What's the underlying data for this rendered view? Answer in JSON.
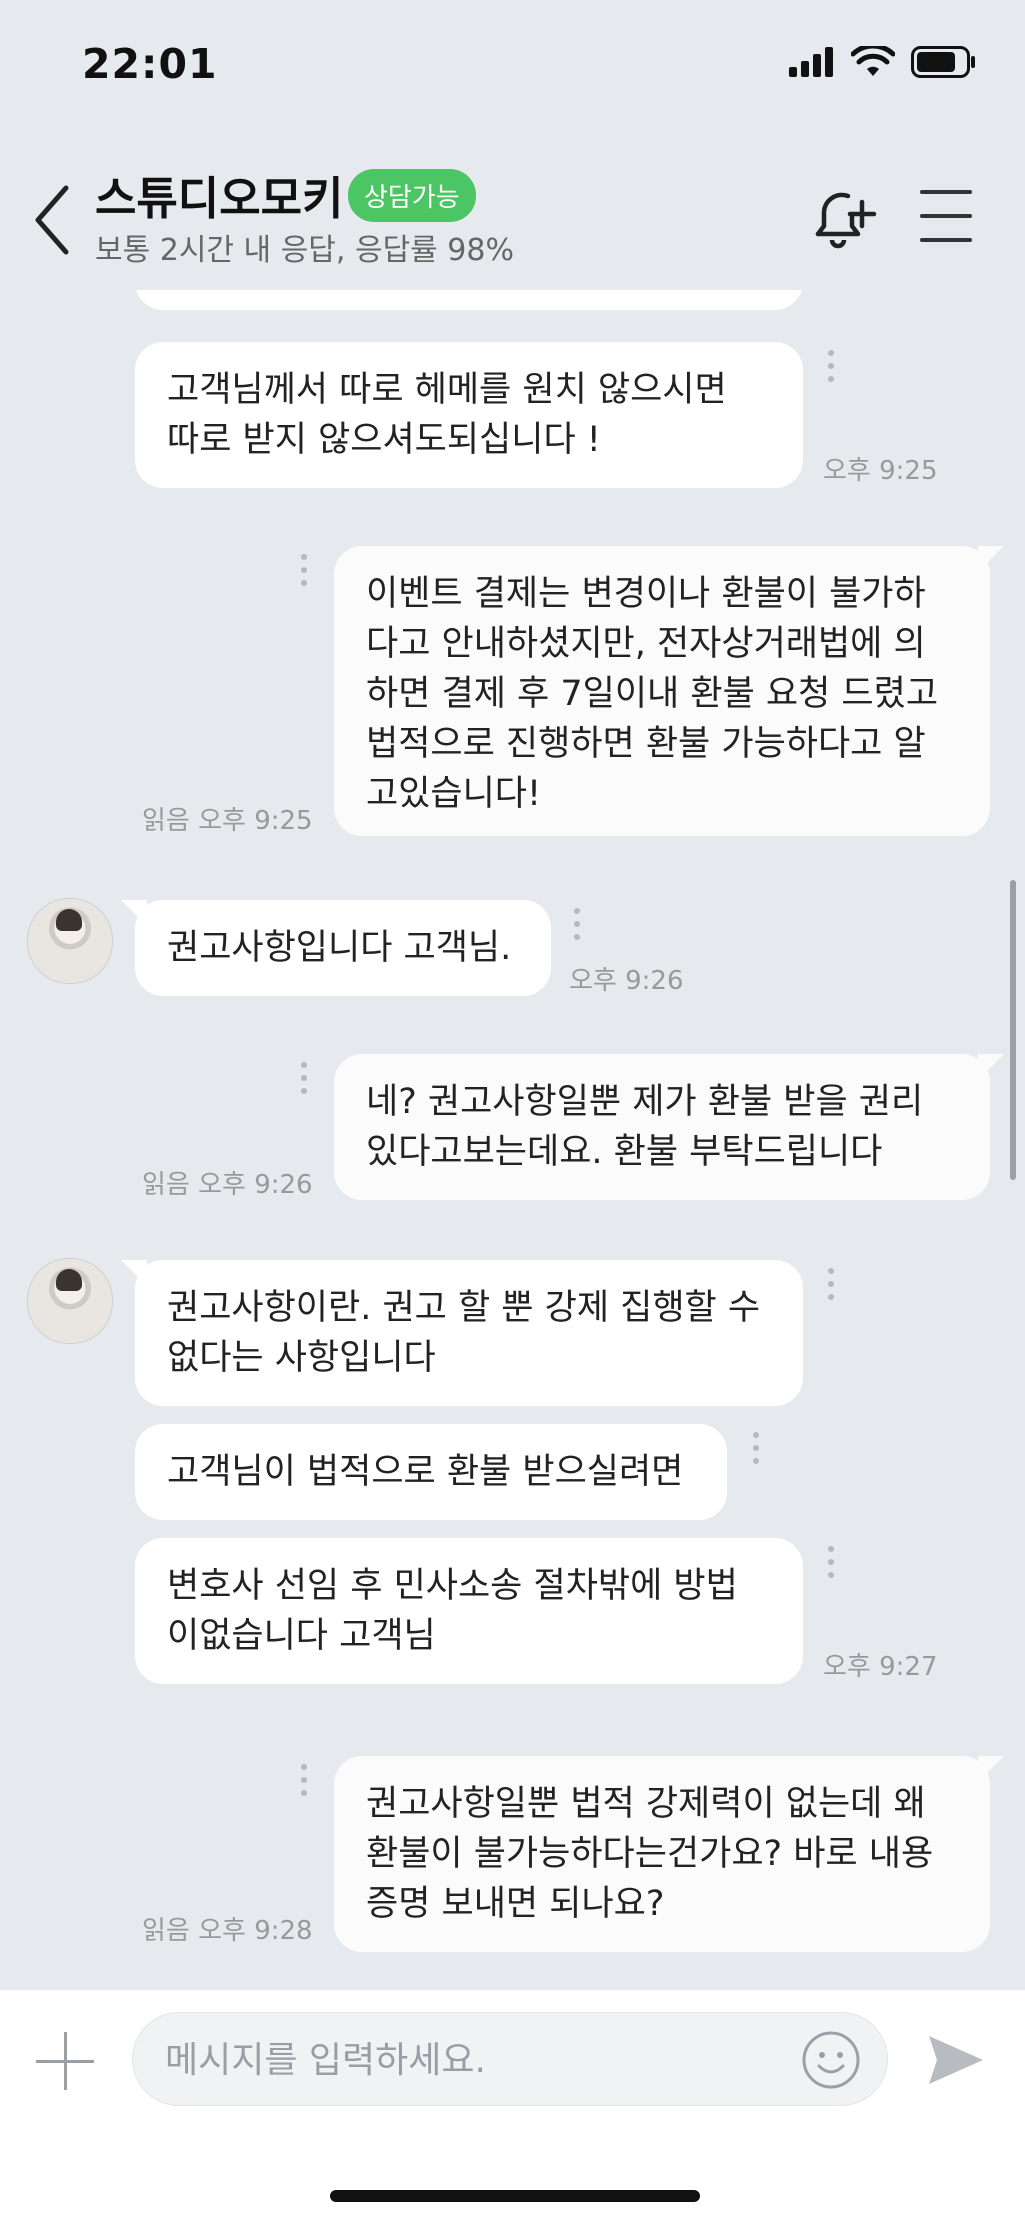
{
  "status": {
    "time": "22:01"
  },
  "header": {
    "title": "스튜디오모키",
    "badge": "상담가능",
    "subtitle": "보통 2시간 내 응답, 응답률 98%"
  },
  "messages": [
    {
      "side": "partner",
      "text": "고객님께서 따로 헤메를 원치 않으시면\n따로 받지 않으셔도되십니다 !",
      "time": "오후 9:25"
    },
    {
      "side": "me",
      "text": "이벤트 결제는 변경이나 환불이 불가하\n다고 안내하셨지만, 전자상거래법에 의\n하면 결제 후 7일이내 환불 요청 드렸고\n법적으로 진행하면 환불 가능하다고 알\n고있습니다!",
      "read": "읽음",
      "time": "오후 9:25"
    },
    {
      "side": "partner",
      "text": "권고사항입니다 고객님.",
      "time": "오후 9:26"
    },
    {
      "side": "me",
      "text": "네? 권고사항일뿐 제가 환불 받을 권리\n있다고보는데요. 환불 부탁드립니다",
      "read": "읽음",
      "time": "오후 9:26"
    },
    {
      "side": "partner",
      "text": "권고사항이란. 권고 할 뿐 강제 집행할 수\n없다는 사항입니다"
    },
    {
      "side": "partner",
      "text": "고객님이 법적으로 환불 받으실려면"
    },
    {
      "side": "partner",
      "text": "변호사 선임 후 민사소송 절차밖에 방법\n이없습니다 고객님",
      "time": "오후 9:27"
    },
    {
      "side": "me",
      "text": "권고사항일뿐 법적 강제력이 없는데 왜\n환불이 불가능하다는건가요? 바로 내용\n증명 보내면 되나요?",
      "read": "읽음",
      "time": "오후 9:28"
    }
  ],
  "composer": {
    "placeholder": "메시지를 입력하세요."
  }
}
